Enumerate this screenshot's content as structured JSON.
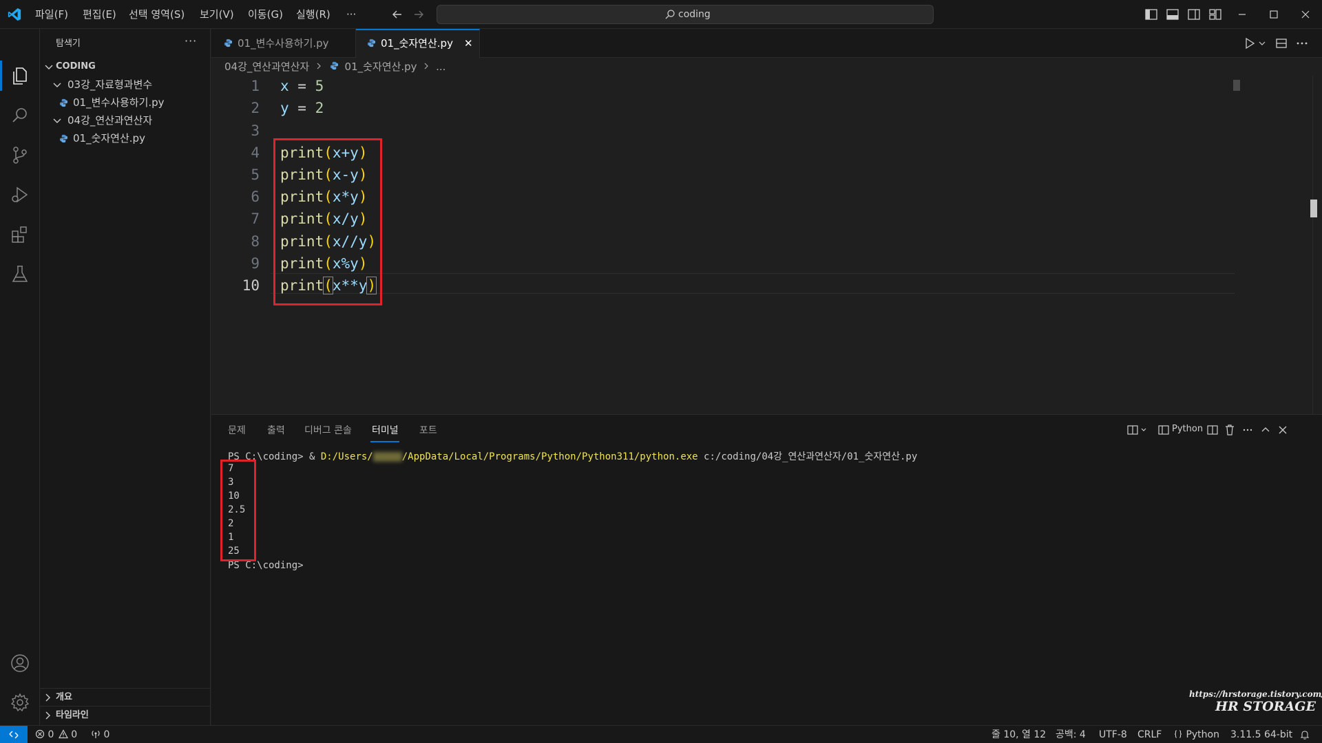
{
  "titlebar": {
    "menus": [
      "파일(F)",
      "편집(E)",
      "선택 영역(S)",
      "보기(V)",
      "이동(G)",
      "실행(R)",
      "···"
    ],
    "search_text": "coding"
  },
  "sidebar": {
    "title": "탐색기",
    "more": "···",
    "root_folder": "CODING",
    "tree": [
      {
        "type": "folder",
        "label": "03강_자료형과변수"
      },
      {
        "type": "file",
        "label": "01_변수사용하기.py"
      },
      {
        "type": "folder",
        "label": "04강_연산과연산자"
      },
      {
        "type": "file",
        "label": "01_숫자연산.py"
      }
    ],
    "outline_label": "개요",
    "timeline_label": "타임라인"
  },
  "tabs": [
    {
      "label": "01_변수사용하기.py",
      "active": false
    },
    {
      "label": "01_숫자연산.py",
      "active": true,
      "close": "✕"
    }
  ],
  "breadcrumb": {
    "folder": "04강_연산과연산자",
    "file": "01_숫자연산.py",
    "tail": "..."
  },
  "editor": {
    "line_numbers": [
      "1",
      "2",
      "3",
      "4",
      "5",
      "6",
      "7",
      "8",
      "9",
      "10"
    ],
    "current_line": "10",
    "lines": [
      {
        "var": "x",
        "op": " = ",
        "num": "5"
      },
      {
        "var": "y",
        "op": " = ",
        "num": "2"
      },
      {},
      {
        "fn": "print",
        "open": "(",
        "expr": "x+y",
        "close": ")"
      },
      {
        "fn": "print",
        "open": "(",
        "expr": "x-y",
        "close": ")"
      },
      {
        "fn": "print",
        "open": "(",
        "expr": "x*y",
        "close": ")"
      },
      {
        "fn": "print",
        "open": "(",
        "expr": "x/y",
        "close": ")"
      },
      {
        "fn": "print",
        "open": "(",
        "expr": "x//y",
        "close": ")"
      },
      {
        "fn": "print",
        "open": "(",
        "expr": "x%y",
        "close": ")"
      },
      {
        "fn": "print",
        "open": "(",
        "expr": "x**y",
        "close": ")"
      }
    ]
  },
  "panel": {
    "tabs": [
      "문제",
      "출력",
      "디버그 콘솔",
      "터미널",
      "포트"
    ],
    "active_tab": "터미널",
    "terminal_profile": "Python",
    "terminal": {
      "prompt": "PS C:\\coding> ",
      "cmd_amp": "& ",
      "cmd_path_a": "D:/Users/",
      "cmd_path_b": "/AppData/Local/Programs/Python/Python311/python.exe",
      "cmd_arg": " c:/coding/04강_연산과연산자/01_숫자연산.py",
      "outputs": [
        "7",
        "3",
        "10",
        "2.5",
        "2",
        "1",
        "25"
      ],
      "final_prompt": "PS C:\\coding>"
    },
    "watermark_url": "https://hrstorage.tistory.com/",
    "watermark_title": "HR STORAGE"
  },
  "statusbar": {
    "errors": "0",
    "warnings": "0",
    "ports": "0",
    "position": "줄 10, 열 12",
    "spaces": "공백: 4",
    "encoding": "UTF-8",
    "eol": "CRLF",
    "language": "Python",
    "interpreter": "3.11.5 64-bit"
  },
  "colors": {
    "accent": "#0078d4",
    "annotation_red": "#e1222b"
  }
}
